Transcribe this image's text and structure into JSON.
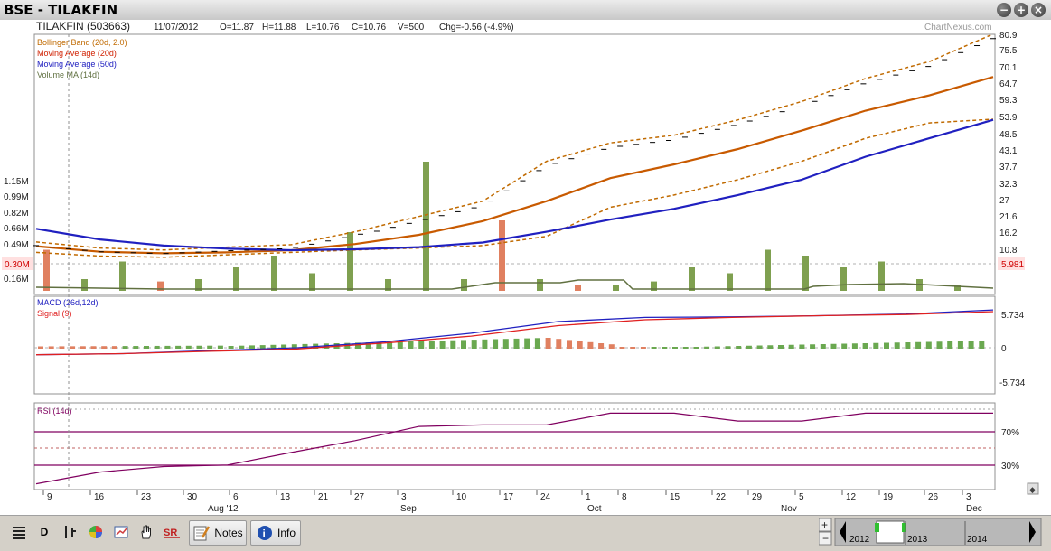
{
  "window": {
    "title": "BSE - TILAKFIN"
  },
  "header": {
    "symbol": "TILAKFIN (503663)",
    "date": "11/07/2012",
    "open": "O=11.87",
    "high": "H=11.88",
    "low": "L=10.76",
    "close": "C=10.76",
    "volume": "V=500",
    "change": "Chg=-0.56 (-4.9%)",
    "watermark": "ChartNexus.com"
  },
  "legend": {
    "bollinger": "Bollinger Band (20d, 2.0)",
    "ma20": "Moving Average (20d)",
    "ma50": "Moving Average (50d)",
    "vma": "Volume MA (14d)",
    "macd": "MACD (26d,12d)",
    "signal": "Signal (9)",
    "rsi": "RSI (14d)"
  },
  "colors": {
    "bollinger": "#c06a00",
    "ma20": "#c85a00",
    "ma50": "#2020c0",
    "vma": "#607040",
    "macd": "#2020c0",
    "signal": "#e02020",
    "rsi": "#800060",
    "volume_up": "#7fa050",
    "volume_down": "#e08060"
  },
  "price_axis": [
    "80.9",
    "75.5",
    "70.1",
    "64.7",
    "59.3",
    "53.9",
    "48.5",
    "43.1",
    "37.7",
    "32.3",
    "27",
    "21.6",
    "16.2",
    "10.8"
  ],
  "last_price": "5.981",
  "volume_axis": [
    "1.15M",
    "0.99M",
    "0.82M",
    "0.66M",
    "0.49M",
    "0.30M",
    "0.16M"
  ],
  "macd_axis": [
    "5.734",
    "0",
    "-5.734"
  ],
  "rsi_axis": [
    "70%",
    "30%"
  ],
  "x_ticks": [
    "9",
    "16",
    "23",
    "30",
    "6",
    "13",
    "21",
    "27",
    "3",
    "10",
    "17",
    "24",
    "1",
    "8",
    "15",
    "22",
    "29",
    "5",
    "12",
    "19",
    "26",
    "3"
  ],
  "x_months": [
    "Aug '12",
    "Sep",
    "Oct",
    "Nov",
    "Dec"
  ],
  "toolbar": {
    "notes": "Notes",
    "info": "Info",
    "d": "D"
  },
  "navigator": {
    "years": [
      "2012",
      "2013",
      "2014"
    ]
  },
  "chart_data": [
    {
      "type": "line",
      "title": "",
      "x": [
        0,
        5,
        10,
        15,
        20,
        25,
        30,
        35,
        40,
        45,
        50,
        55,
        60,
        65,
        70,
        75,
        80,
        85,
        90,
        95,
        100
      ],
      "series": [
        {
          "name": "Bollinger Band (20d, 2.0)",
          "values": [
            13.2,
            11.2,
            10.6,
            11.5,
            12.3,
            16.5,
            21.5,
            26.5,
            39.5,
            45.5,
            48.0,
            53.0,
            59.0,
            66.5,
            72.0,
            81.0
          ]
        },
        {
          "name": "Bollinger Band (20d, 2.0)",
          "values": [
            9.8,
            8.6,
            8.2,
            9.0,
            9.8,
            10.6,
            11.2,
            12.0,
            15.0,
            24.5,
            28.5,
            33.5,
            39.5,
            47.0,
            52.0,
            53.2
          ]
        },
        {
          "name": "Moving Average (20d)",
          "values": [
            11.8,
            10.0,
            9.5,
            9.8,
            10.5,
            12.5,
            15.5,
            20.0,
            26.5,
            34.0,
            38.5,
            43.5,
            49.5,
            56.0,
            61.0,
            67.0
          ]
        },
        {
          "name": "Moving Average (50d)",
          "values": [
            17.5,
            14.0,
            12.0,
            11.0,
            10.5,
            10.8,
            11.5,
            13.0,
            16.5,
            20.5,
            24.0,
            28.5,
            33.5,
            41.0,
            47.0,
            53.0
          ]
        }
      ],
      "ylim": [
        5.981,
        80.9
      ]
    },
    {
      "type": "bar",
      "title": "",
      "series": [
        {
          "name": "volume",
          "values": [
            0.35,
            0.1,
            0.25,
            0.08,
            0.1,
            0.2,
            0.3,
            0.15,
            0.5,
            0.1,
            1.1,
            0.1,
            0.6,
            0.1,
            0.05,
            0.05,
            0.08,
            0.2,
            0.15,
            0.35,
            0.3,
            0.2,
            0.25,
            0.1,
            0.05
          ]
        }
      ]
    },
    {
      "type": "line",
      "title": "",
      "series": [
        {
          "name": "MACD (26d,12d)",
          "values": [
            -1.2,
            -1.0,
            -0.5,
            0.0,
            1.0,
            2.5,
            4.5,
            5.2,
            5.3,
            5.5,
            5.8,
            6.5
          ]
        },
        {
          "name": "Signal (9)",
          "values": [
            -1.2,
            -1.0,
            -0.6,
            -0.2,
            0.8,
            2.0,
            3.8,
            4.8,
            5.2,
            5.5,
            5.7,
            6.2
          ]
        }
      ],
      "ylim": [
        -5.734,
        5.734
      ]
    },
    {
      "type": "line",
      "title": "",
      "series": [
        {
          "name": "RSI (14d)",
          "values": [
            5,
            20,
            27,
            29,
            45,
            60,
            78,
            80,
            80,
            95,
            95,
            85,
            85,
            95,
            95,
            95
          ]
        }
      ],
      "ylim": [
        0,
        100
      ]
    }
  ]
}
